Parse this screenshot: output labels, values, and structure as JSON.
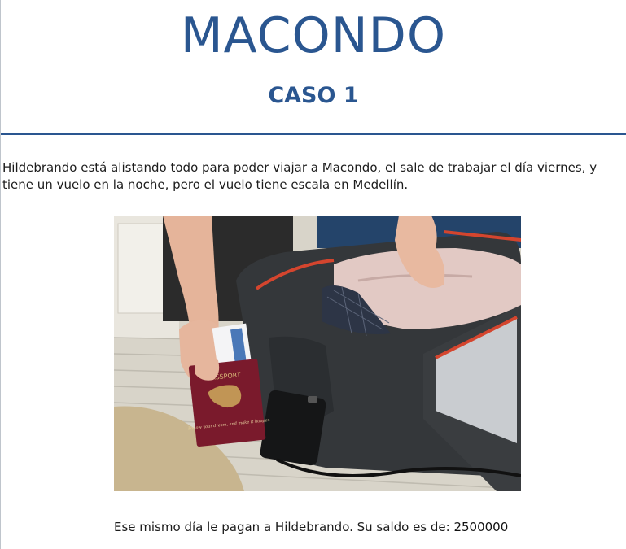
{
  "header": {
    "title": "MACONDO",
    "subtitle": "CASO 1"
  },
  "story": {
    "intro": "Hildebrando está alistando todo para poder viajar a Macondo, el sale de trabajar el día viernes, y tiene un vuelo en la noche, pero el vuelo tiene escala en Medellín.",
    "passport_text_1": "PASSPORT",
    "passport_text_2": "Follow your dream, and make it happen",
    "balance_label": "Ese mismo día le pagan a Hildebrando. Su saldo es de: ",
    "balance_value": "2500000"
  },
  "colors": {
    "accent": "#2a5690",
    "text": "#1c1c1c",
    "passport": "#7a1a2c",
    "suitcase": "#2f3235",
    "suitcase_trim": "#d4452e"
  }
}
